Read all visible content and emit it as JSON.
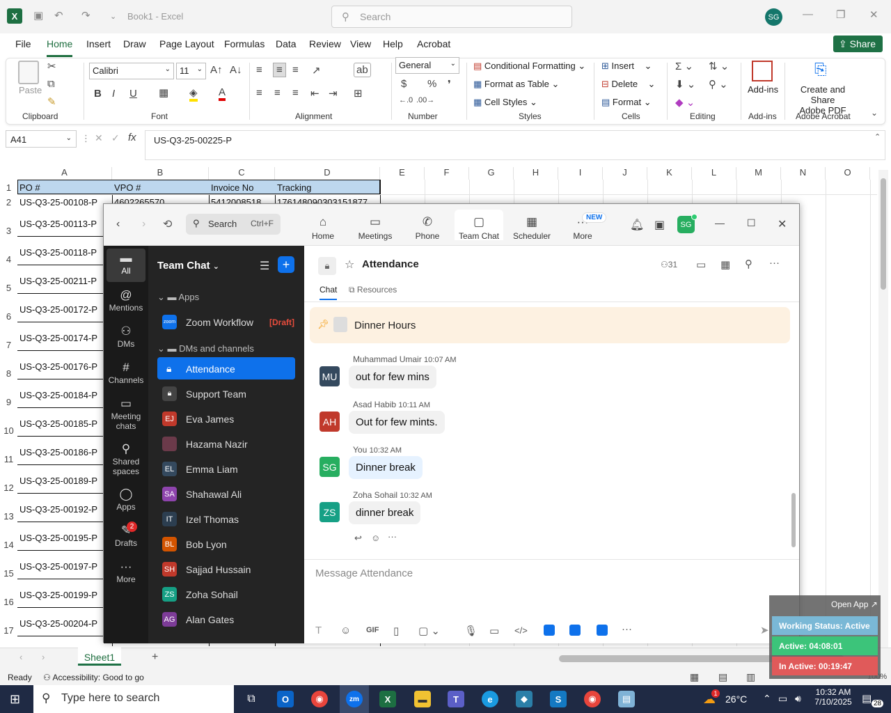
{
  "excel": {
    "doc_title": "Book1  -  Excel",
    "search_placeholder": "Search",
    "avatar": "SG",
    "menu": [
      "File",
      "Home",
      "Insert",
      "Draw",
      "Page Layout",
      "Formulas",
      "Data",
      "Review",
      "View",
      "Help",
      "Acrobat"
    ],
    "share": "Share",
    "ribbon": {
      "paste": "Paste",
      "clipboard": "Clipboard",
      "font_name": "Calibri",
      "font_size": "11",
      "font": "Font",
      "alignment": "Alignment",
      "number_format": "General",
      "number": "Number",
      "conditional": "Conditional Formatting",
      "format_table": "Format as Table",
      "cell_styles": "Cell Styles",
      "styles": "Styles",
      "insert": "Insert",
      "delete": "Delete",
      "format": "Format",
      "cells": "Cells",
      "editing": "Editing",
      "addins": "Add-ins",
      "addins_group": "Add-ins",
      "create_share": "Create and Share",
      "adobe_pdf": "Adobe PDF",
      "adobe_group": "Adobe Acrobat"
    },
    "name_box": "A41",
    "formula": "US-Q3-25-00225-P",
    "columns": [
      "A",
      "B",
      "C",
      "D",
      "E",
      "F",
      "G",
      "H",
      "I",
      "J",
      "K",
      "L",
      "M",
      "N",
      "O"
    ],
    "rows": [
      "1",
      "2",
      "3",
      "4",
      "5",
      "6",
      "7",
      "8",
      "9",
      "10",
      "11",
      "12",
      "13",
      "14",
      "15",
      "16",
      "17"
    ],
    "headers": [
      "PO #",
      "VPO #",
      "Invoice No",
      "Tracking"
    ],
    "row2": [
      "US-Q3-25-00108-P",
      "4602265570",
      "5412008518",
      "176148090303151877"
    ],
    "po_list": [
      "US-Q3-25-00113-P",
      "US-Q3-25-00118-P",
      "US-Q3-25-00211-P",
      "US-Q3-25-00172-P",
      "US-Q3-25-00174-P",
      "US-Q3-25-00176-P",
      "US-Q3-25-00184-P",
      "US-Q3-25-00185-P",
      "US-Q3-25-00186-P",
      "US-Q3-25-00189-P",
      "US-Q3-25-00192-P",
      "US-Q3-25-00195-P",
      "US-Q3-25-00197-P",
      "US-Q3-25-00199-P",
      "US-Q3-25-00204-P"
    ],
    "sheet_tab": "Sheet1",
    "status_ready": "Ready",
    "status_access": "Accessibility: Good to go",
    "zoom_pct": "100%"
  },
  "zoom": {
    "search": "Search",
    "search_kb": "Ctrl+F",
    "nav": [
      "Home",
      "Meetings",
      "Phone",
      "Team Chat",
      "Scheduler",
      "More"
    ],
    "new_badge": "NEW",
    "avatar": "SG",
    "rail": [
      "All",
      "Mentions",
      "DMs",
      "Channels",
      "Meeting chats",
      "Shared spaces",
      "Apps",
      "Drafts",
      "More"
    ],
    "drafts_count": "2",
    "side_title": "Team Chat",
    "apps_hdr": "Apps",
    "workflow": "Zoom Workflow",
    "draft_tag": "[Draft]",
    "dms_hdr": "DMs and channels",
    "channels": [
      {
        "label": "Attendance",
        "av": "",
        "color": "#0e71eb"
      },
      {
        "label": "Support Team",
        "av": "",
        "color": "#444"
      },
      {
        "label": "Eva James",
        "av": "EJ",
        "color": "#c0392b"
      },
      {
        "label": "Hazama Nazir",
        "av": "",
        "color": "#6b3a4a"
      },
      {
        "label": "Emma Liam",
        "av": "EL",
        "color": "#34495e"
      },
      {
        "label": "Shahawal Ali",
        "av": "SA",
        "color": "#8e44ad"
      },
      {
        "label": "Izel Thomas",
        "av": "IT",
        "color": "#2c3e50"
      },
      {
        "label": "Bob Lyon",
        "av": "BL",
        "color": "#d35400"
      },
      {
        "label": "Sajjad Hussain",
        "av": "SH",
        "color": "#c0392b"
      },
      {
        "label": "Zoha Sohail",
        "av": "ZS",
        "color": "#16a085"
      },
      {
        "label": "Alan Gates",
        "av": "AG",
        "color": "#7d3c98"
      }
    ],
    "channel_title": "Attendance",
    "members": "31",
    "tab_chat": "Chat",
    "tab_resources": "Resources",
    "pinned": "Dinner Hours",
    "messages": [
      {
        "name": "Muhammad Umair",
        "time": "10:07 AM",
        "text": "out for few mins",
        "av": "MU",
        "color": "#34495e"
      },
      {
        "name": "Asad Habib",
        "time": "10:11 AM",
        "text": "Out for few mints.",
        "av": "AH",
        "color": "#c0392b"
      },
      {
        "name": "You",
        "time": "10:32 AM",
        "text": "Dinner break",
        "av": "SG",
        "color": "#27ae60"
      },
      {
        "name": "Zoha Sohail",
        "time": "10:32 AM",
        "text": "dinner break",
        "av": "ZS",
        "color": "#16a085"
      }
    ],
    "compose_placeholder": "Message Attendance",
    "gif": "GIF"
  },
  "overlay": {
    "open_app": "Open App ↗",
    "status": "Working Status: Active",
    "active": "Active: 04:08:01",
    "inactive": "In Active: 00:19:47"
  },
  "taskbar": {
    "search": "Type here to search",
    "temp": "26°C",
    "time": "10:32 AM",
    "date": "7/10/2025",
    "notif": "28",
    "weather_badge": "1"
  }
}
